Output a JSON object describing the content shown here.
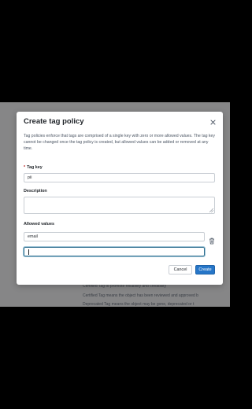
{
  "modal": {
    "title": "Create tag policy",
    "close_icon": "close-icon",
    "description": "Tag policies enforce that tags are comprised of a single key with zero or more allowed values. The tag key cannot be changed once the tag policy is created, but allowed values can be added or removed at any time.",
    "tag_key": {
      "required_mark": "*",
      "label": "Tag key",
      "value": "pii"
    },
    "description_field": {
      "label": "Description",
      "value": ""
    },
    "allowed_values": {
      "label": "Allowed values",
      "items": [
        {
          "value": "email",
          "delete_icon": "trash-icon"
        },
        {
          "value": ""
        }
      ]
    },
    "buttons": {
      "cancel": "Cancel",
      "create": "Create"
    }
  },
  "background": {
    "lines": [
      "Certified Tag to promote reliability and credibility",
      "Certified Tag means the object has been reviewed and approved b",
      "Deprecated Tag means the object may be gone, deprecated or t"
    ]
  },
  "colors": {
    "primary": "#2676c8",
    "focus": "#2f6f8f",
    "overlay": "rgba(0,0,0,0.45)"
  }
}
